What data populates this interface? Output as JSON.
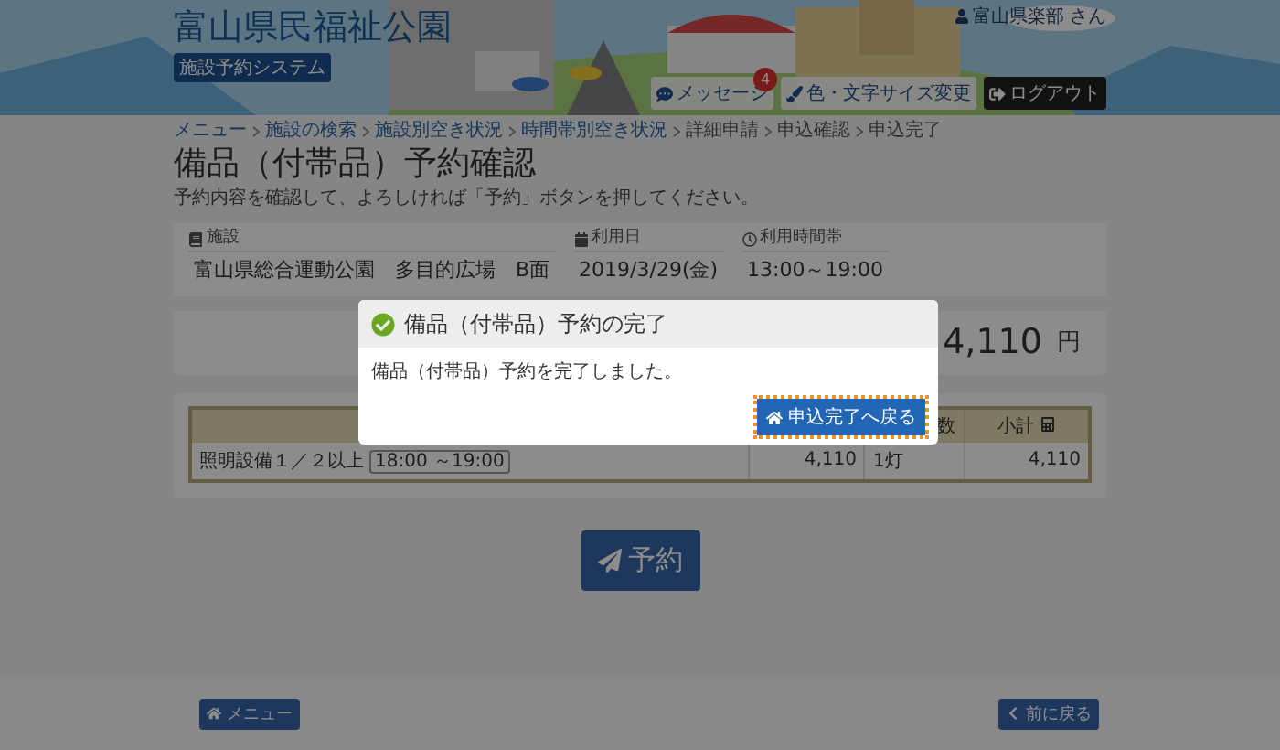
{
  "header": {
    "site_title": "富山県民福祉公園",
    "system_badge": "施設予約システム",
    "user": "富山県楽部 さん",
    "buttons": [
      {
        "kind": "message",
        "label": "メッセージ",
        "count": "4"
      },
      {
        "kind": "display",
        "label": "色・文字サイズ変更"
      },
      {
        "kind": "logout",
        "label": "ログアウト"
      }
    ]
  },
  "breadcrumb": [
    {
      "label": "メニュー",
      "link": true
    },
    {
      "label": "施設の検索",
      "link": true
    },
    {
      "label": "施設別空き状況",
      "link": true
    },
    {
      "label": "時間帯別空き状況",
      "link": true
    },
    {
      "label": "詳細申請",
      "link": false
    },
    {
      "label": "申込確認",
      "link": false
    },
    {
      "label": "申込完了",
      "link": false
    }
  ],
  "page_title": "備品（付帯品）予約確認",
  "instruction": "予約内容を確認して、よろしければ「予約」ボタンを押してください。",
  "reservation": {
    "fields": [
      {
        "kind": "facility",
        "label": "施設",
        "value": "富山県総合運動公園　多目的広場　B面"
      },
      {
        "kind": "date",
        "label": "利用日",
        "value": "2019/3/29(金)"
      },
      {
        "kind": "time",
        "label": "利用時間帯",
        "value": "13:00～19:00"
      }
    ]
  },
  "total": {
    "amount": "4,110",
    "unit": "円"
  },
  "table": {
    "header": {
      "column_3": "数",
      "column_4": "小計"
    },
    "rows": [
      {
        "item": "照明設備１／２以上",
        "time_slot": "18:00 ～19:00",
        "unit_price": "4,110",
        "quantity": "1灯",
        "subtotal": "4,110"
      }
    ]
  },
  "submit_button": "予約",
  "footer": {
    "menu_button": "メニュー",
    "back_button": "前に戻る"
  },
  "dialog": {
    "title": "備品（付帯品）予約の完了",
    "message": "備品（付帯品）予約を完了しました。",
    "button": "申込完了へ戻る"
  }
}
